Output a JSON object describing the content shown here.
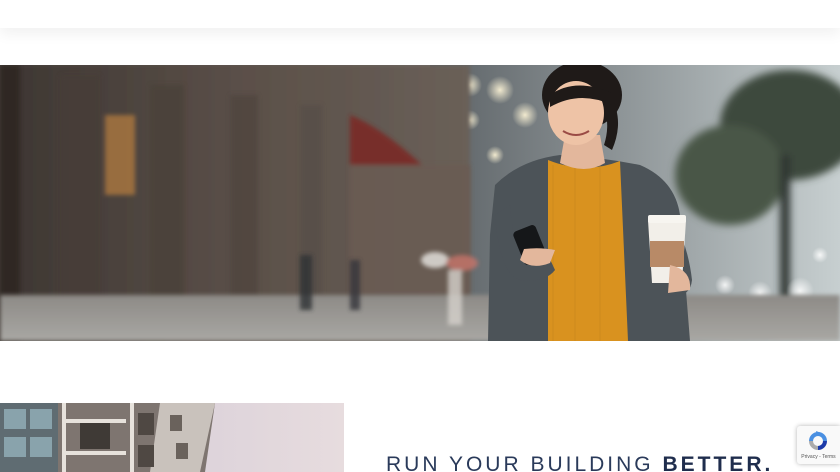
{
  "hero": {
    "image_alt": "Woman smiling at smartphone holding coffee cup on a city street"
  },
  "section": {
    "headline_light": "RUN YOUR BUILDING ",
    "headline_bold": "BETTER."
  },
  "building_image": {
    "image_alt": "Modern apartment building with balconies"
  },
  "recaptcha": {
    "privacy_label": "Privacy",
    "separator": " - ",
    "terms_label": "Terms"
  },
  "colors": {
    "headline": "#2a3a5a",
    "sweater": "#d9921f",
    "coat": "#4c5358"
  }
}
